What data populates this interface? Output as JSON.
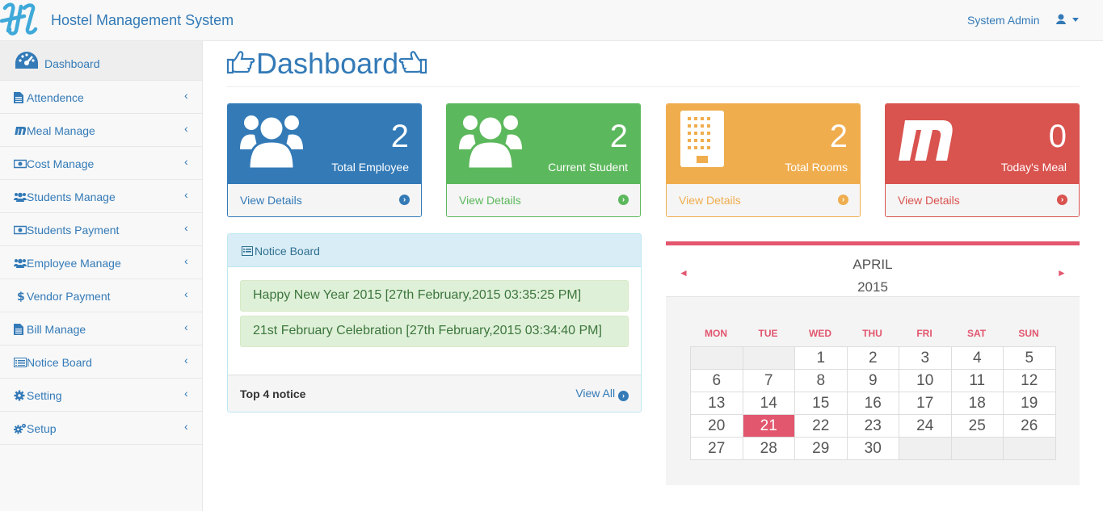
{
  "header": {
    "brand": "Hostel Management System",
    "user": "System Admin",
    "logo_icon": "hm-logo-icon",
    "user_icon": "user-icon"
  },
  "sidebar": {
    "items": [
      {
        "label": "Dashboard",
        "icon": "tachometer-icon"
      },
      {
        "label": "Attendence",
        "icon": "file-icon",
        "chevron": "‹"
      },
      {
        "label": "Meal Manage",
        "icon": "meal-m-icon",
        "chevron": "‹"
      },
      {
        "label": "Cost Manage",
        "icon": "money-icon",
        "chevron": "‹"
      },
      {
        "label": "Students Manage",
        "icon": "users-icon",
        "chevron": "‹"
      },
      {
        "label": "Students Payment",
        "icon": "money-icon",
        "chevron": "‹"
      },
      {
        "label": "Employee Manage",
        "icon": "users-icon",
        "chevron": "‹"
      },
      {
        "label": "Vendor Payment",
        "icon": "dollar-icon",
        "chevron": "‹"
      },
      {
        "label": "Bill Manage",
        "icon": "file-icon",
        "chevron": "‹"
      },
      {
        "label": "Notice Board",
        "icon": "list-alt-icon",
        "chevron": "‹"
      },
      {
        "label": "Setting",
        "icon": "gear-icon",
        "chevron": "‹"
      },
      {
        "label": "Setup",
        "icon": "gears-icon",
        "chevron": "‹"
      }
    ]
  },
  "page": {
    "title": "Dashboard"
  },
  "panels": [
    {
      "value": "2",
      "caption": "Total Employee",
      "link": "View Details",
      "color": "#337ab7"
    },
    {
      "value": "2",
      "caption": "Current Student",
      "link": "View Details",
      "color": "#5cb85c"
    },
    {
      "value": "2",
      "caption": "Total Rooms",
      "link": "View Details",
      "color": "#f0ad4e"
    },
    {
      "value": "0",
      "caption": "Today's Meal",
      "link": "View Details",
      "color": "#d9534f"
    }
  ],
  "notice_board": {
    "title": "Notice Board",
    "notices": [
      "Happy New Year 2015 [27th February,2015 03:35:25 PM]",
      "21st February Celebration [27th February,2015 03:34:40 PM]"
    ],
    "footer_label": "Top 4 notice",
    "view_all": "View All"
  },
  "calendar": {
    "month": "APRIL",
    "year": "2015",
    "prev": "◄",
    "next": "►",
    "weekdays": [
      "MON",
      "TUE",
      "WED",
      "THU",
      "FRI",
      "SAT",
      "SUN"
    ],
    "weeks": [
      [
        "",
        "",
        "1",
        "2",
        "3",
        "4",
        "5"
      ],
      [
        "6",
        "7",
        "8",
        "9",
        "10",
        "11",
        "12"
      ],
      [
        "13",
        "14",
        "15",
        "16",
        "17",
        "18",
        "19"
      ],
      [
        "20",
        "21",
        "22",
        "23",
        "24",
        "25",
        "26"
      ],
      [
        "27",
        "28",
        "29",
        "30",
        "",
        "",
        ""
      ]
    ],
    "today": "21",
    "accent": "#e2566e"
  }
}
